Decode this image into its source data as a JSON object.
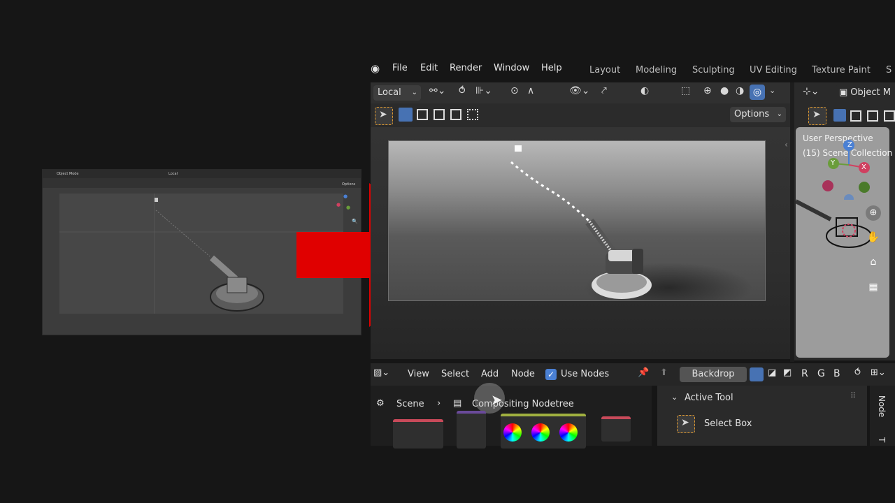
{
  "thumbnail": {
    "mode": "Object Mode",
    "orientation": "Local",
    "options": "Options"
  },
  "menu": {
    "items": [
      "File",
      "Edit",
      "Render",
      "Window",
      "Help"
    ],
    "workspaces": [
      "Layout",
      "Modeling",
      "Sculpting",
      "UV Editing",
      "Texture Paint",
      "S"
    ]
  },
  "viewport": {
    "orientation": "Local",
    "options_label": "Options"
  },
  "right_view": {
    "mode_label": "Object M",
    "perspective": "User Perspective",
    "collection": "(15) Scene Collection",
    "axes": {
      "x": "X",
      "y": "Y",
      "z": "Z"
    }
  },
  "node_editor": {
    "menus": [
      "View",
      "Select",
      "Add",
      "Node"
    ],
    "use_nodes_label": "Use Nodes",
    "use_nodes_checked": true,
    "backdrop_label": "Backdrop",
    "channels": [
      "R",
      "G",
      "B"
    ],
    "breadcrumb_scene": "Scene",
    "breadcrumb_tree": "Compositing Nodetree",
    "active_tool_title": "Active Tool",
    "select_box_label": "Select Box",
    "side_tab": "Node",
    "side_tab2": "T"
  },
  "colors": {
    "accent_blue": "#4772b3",
    "arrow_red": "#e00000",
    "checkbox": "#4a80d4"
  }
}
